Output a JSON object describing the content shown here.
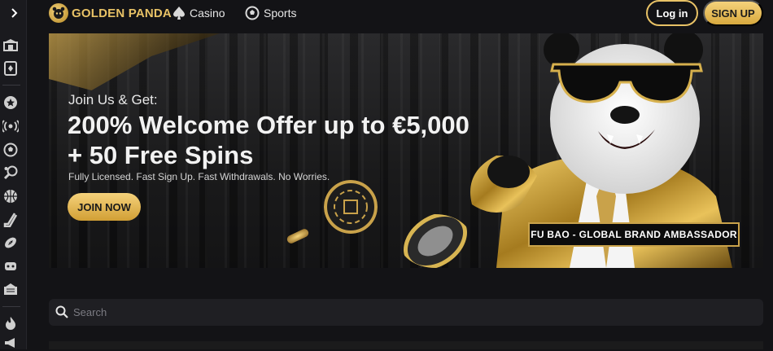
{
  "header": {
    "logo_text": "GOLDEN PANDA",
    "nav": [
      {
        "label": "Casino",
        "icon": "spade-icon"
      },
      {
        "label": "Sports",
        "icon": "soccer-ball-icon"
      }
    ],
    "login_label": "Log in",
    "signup_label": "SIGN UP"
  },
  "sidebar": {
    "items": [
      {
        "icon": "casino-building-icon"
      },
      {
        "icon": "cards-icon"
      },
      {
        "icon": "star-icon"
      },
      {
        "icon": "live-broadcast-icon"
      },
      {
        "icon": "soccer-ball-icon"
      },
      {
        "icon": "tennis-icon"
      },
      {
        "icon": "basketball-icon"
      },
      {
        "icon": "hockey-stick-icon"
      },
      {
        "icon": "american-football-icon"
      },
      {
        "icon": "esports-icon"
      },
      {
        "icon": "ticket-icon"
      },
      {
        "icon": "fire-icon"
      },
      {
        "icon": "megaphone-icon"
      }
    ]
  },
  "hero": {
    "subtitle": "Join Us & Get:",
    "title_line1": "200% Welcome Offer up to €5,000",
    "title_line2": "+ 50 Free Spins",
    "note": "Fully Licensed. Fast Sign Up. Fast Withdrawals. No Worries.",
    "cta_label": "JOIN NOW",
    "ambassador_label": "FU BAO - GLOBAL BRAND AMBASSADOR"
  },
  "search": {
    "placeholder": "Search",
    "value": ""
  },
  "colors": {
    "gold": "#e8c266",
    "background": "#131316",
    "rail": "#1a1a1e"
  }
}
